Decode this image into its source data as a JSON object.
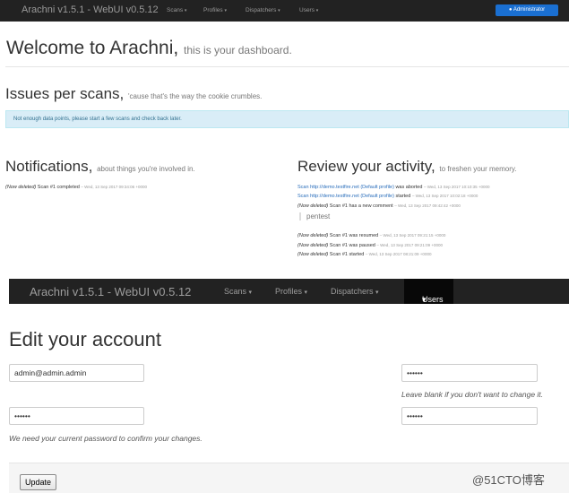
{
  "top": {
    "nav": {
      "brand": "Arachni v1.5.1 - WebUI v0.5.12",
      "items": [
        "Scans",
        "Profiles",
        "Dispatchers",
        "Users"
      ],
      "caret": "▾",
      "admin": "Administrator"
    },
    "welcome": {
      "title": "Welcome to Arachni,",
      "subtitle": "this is your dashboard."
    },
    "issues": {
      "title": "Issues per scans,",
      "subtitle": "'cause that's the way the cookie crumbles.",
      "alert": "Not enough data points, please start a few scans and check back later."
    },
    "notifications": {
      "title": "Notifications,",
      "subtitle": "about things you're involved in.",
      "items": [
        {
          "deleted": "(Now deleted)",
          "text": "Scan #1 completed",
          "ts": "– Wed, 13 Sep 2017 09:34:06 +0000"
        }
      ]
    },
    "review": {
      "title": "Review your activity,",
      "subtitle": "to freshen your memory.",
      "items": [
        {
          "link": "Scan http://demo.testfire.net (Default profile)",
          "text": "was aborted",
          "ts": "– Wed, 13 Sep 2017 10:10:35 +0000"
        },
        {
          "link": "Scan http://demo.testfire.net (Default profile)",
          "text": "started",
          "ts": "– Wed, 13 Sep 2017 10:02:18 +0000"
        },
        {
          "deleted": "(Now deleted)",
          "text": "Scan #1 has a new comment",
          "ts": "– Wed, 13 Sep 2017 09:42:42 +0000"
        },
        {
          "deleted": "(Now deleted)",
          "text": "Scan #1 was resumed",
          "ts": "– Wed, 13 Sep 2017 09:21:15 +0000"
        },
        {
          "deleted": "(Now deleted)",
          "text": "Scan #1 was paused",
          "ts": "– Wed, 13 Sep 2017 09:21:09 +0000"
        },
        {
          "deleted": "(Now deleted)",
          "text": "Scan #1 started",
          "ts": "– Wed, 13 Sep 2017 08:21:09 +0000"
        }
      ],
      "comment": "pentest"
    }
  },
  "bottom": {
    "nav": {
      "brand": "Arachni v1.5.1 - WebUI v0.5.12",
      "items": [
        "Scans",
        "Profiles",
        "Dispatchers",
        "Users"
      ],
      "caret": "▾"
    },
    "title": "Edit your account",
    "email_value": "admin@admin.admin",
    "password_value": "••••••",
    "password_confirm_value": "••••••",
    "current_password_value": "••••••",
    "help_password": "Leave blank if you don't want to change it.",
    "help_current": "We need your current password to confirm your changes.",
    "update_label": "Update"
  },
  "watermark": "@51CTO博客",
  "colors": {
    "navbar": "#222222",
    "admin_button": "#1a6fd1",
    "alert_bg": "#d9edf7",
    "link": "#2a6ebb"
  }
}
